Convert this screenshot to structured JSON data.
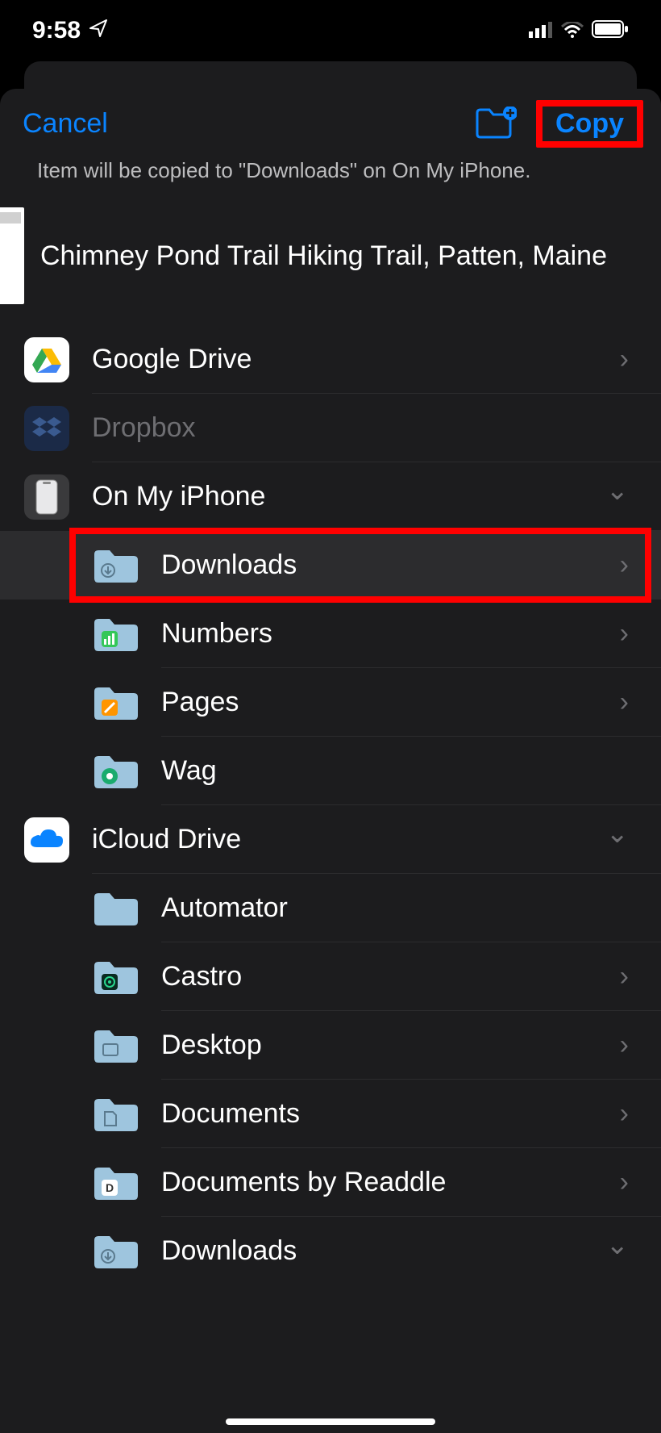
{
  "status": {
    "time": "9:58",
    "nav_glyph": "➤"
  },
  "header": {
    "cancel": "Cancel",
    "copy": "Copy"
  },
  "subtitle": "Item will be copied to \"Downloads\" on On My iPhone.",
  "item": {
    "title": "Chimney Pond Trail Hiking Trail, Patten, Maine"
  },
  "locations": {
    "gdrive": "Google Drive",
    "dropbox": "Dropbox",
    "oniphone": "On My iPhone",
    "iphone_children": {
      "downloads": "Downloads",
      "numbers": "Numbers",
      "pages": "Pages",
      "wag": "Wag"
    },
    "icloud": "iCloud Drive",
    "icloud_children": {
      "automator": "Automator",
      "castro": "Castro",
      "desktop": "Desktop",
      "documents": "Documents",
      "documents_readdle": "Documents by Readdle",
      "downloads2": "Downloads"
    }
  }
}
